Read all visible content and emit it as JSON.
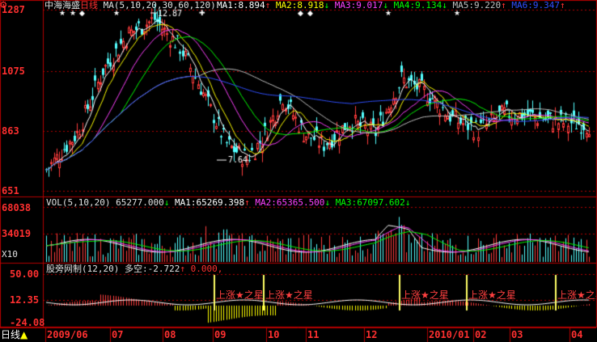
{
  "colors": {
    "bg": "#000000",
    "frame": "#b40000",
    "up": "#ff3c3c",
    "down": "#54ffff",
    "ma1": "#ffffff",
    "ma2": "#ffff00",
    "ma3": "#ff40ff",
    "ma4": "#00ff00",
    "ma5": "#c0c0c0",
    "ma6": "#3050ff",
    "axis_text": "#ff3030",
    "hilite": "#ffff66"
  },
  "price_panel": {
    "stock_name": "中海海盛",
    "period": "日线",
    "ma_label": "MA(5,10,20,30,60,120)",
    "ma_items": [
      {
        "label": "MA1:",
        "value": "8.894",
        "arrow": "↑",
        "color_key": "ma1"
      },
      {
        "label": "MA2:",
        "value": "8.918",
        "arrow": "↓",
        "color_key": "ma2"
      },
      {
        "label": "MA3:",
        "value": "9.017",
        "arrow": "↓",
        "color_key": "ma3"
      },
      {
        "label": "MA4:",
        "value": "9.134",
        "arrow": "↓",
        "color_key": "ma4"
      },
      {
        "label": "MA5:",
        "value": "9.220",
        "arrow": "↑",
        "color_key": "ma5"
      },
      {
        "label": "MA6:",
        "value": "9.347",
        "arrow": "↑",
        "color_key": "ma6"
      }
    ],
    "y_ticks": [
      "1287",
      "1075",
      "863",
      "651"
    ],
    "high_label": "12.87",
    "low_label": "7.64"
  },
  "volume_panel": {
    "label": "VOL(5,10,20)",
    "value": "65277.000",
    "value_arrow": "↓",
    "ma_items": [
      {
        "label": "MA1:",
        "value": "65269.398",
        "arrow": "↑",
        "color_key": "ma1"
      },
      {
        "label": "MA2:",
        "value": "65365.500",
        "arrow": "↓",
        "color_key": "ma3"
      },
      {
        "label": "MA3:",
        "value": "67097.602",
        "arrow": "↓",
        "color_key": "ma4"
      }
    ],
    "y_ticks": [
      "68038",
      "34019"
    ],
    "unit": "X10"
  },
  "indicator_panel": {
    "label": "股旁网制(12,20)",
    "item_label": "多空:",
    "item_value": "-2.722",
    "item_arrow": "↑",
    "extra_value": "0.000,",
    "y_ticks": [
      "50.00",
      "12.35",
      "-24.08"
    ],
    "signal_text": "上涨★之星"
  },
  "bottom_bar": {
    "period_button": "日线",
    "dates": [
      "2009/06",
      "07",
      "08",
      "09",
      "10",
      "11",
      "12",
      "2010/01",
      "02",
      "03",
      "04"
    ]
  }
}
